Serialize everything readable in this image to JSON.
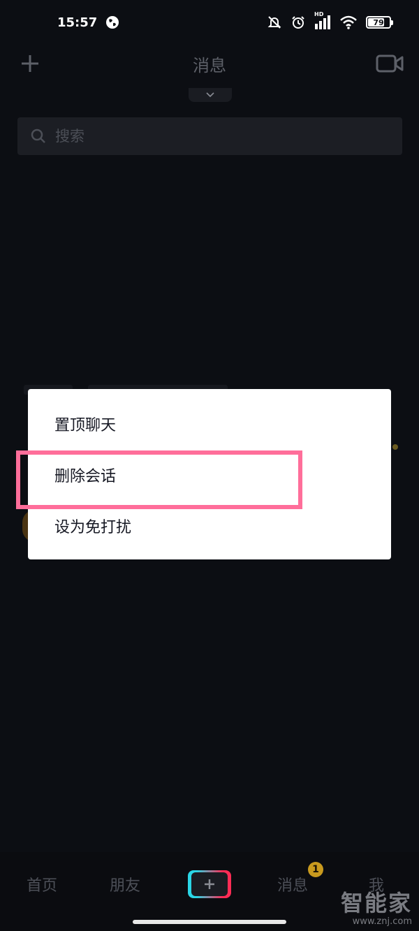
{
  "status_bar": {
    "time": "15:57",
    "network_label": "HD",
    "battery": "79",
    "battery_level": 0.79,
    "icons": [
      "globe-icon",
      "mute-bell-icon",
      "alarm-icon",
      "signal-icon",
      "wifi-icon",
      "battery-icon"
    ]
  },
  "header": {
    "title": "消息",
    "left_icon": "plus-icon",
    "right_icon": "video-camera-icon"
  },
  "search": {
    "placeholder": "搜索",
    "value": ""
  },
  "context_menu": {
    "items": [
      {
        "label": "置顶聊天"
      },
      {
        "label": "删除会话"
      },
      {
        "label": "设为免打扰"
      }
    ],
    "highlighted_index": 1,
    "highlight_color": "#ff6e9a"
  },
  "tab_bar": {
    "tabs": [
      {
        "label": "首页"
      },
      {
        "label": "朋友"
      },
      {
        "label": "消息"
      },
      {
        "label": "我"
      }
    ],
    "create_icon": "plus-icon",
    "messages_badge": "1"
  },
  "watermark": {
    "name": "智能家",
    "url": "www.znj.com"
  },
  "colors": {
    "background": "#0c0e13",
    "menu_background": "#ffffff",
    "badge": "#c99a1e",
    "accent_cyan": "#2ad6e6",
    "accent_red": "#fe2c55"
  }
}
